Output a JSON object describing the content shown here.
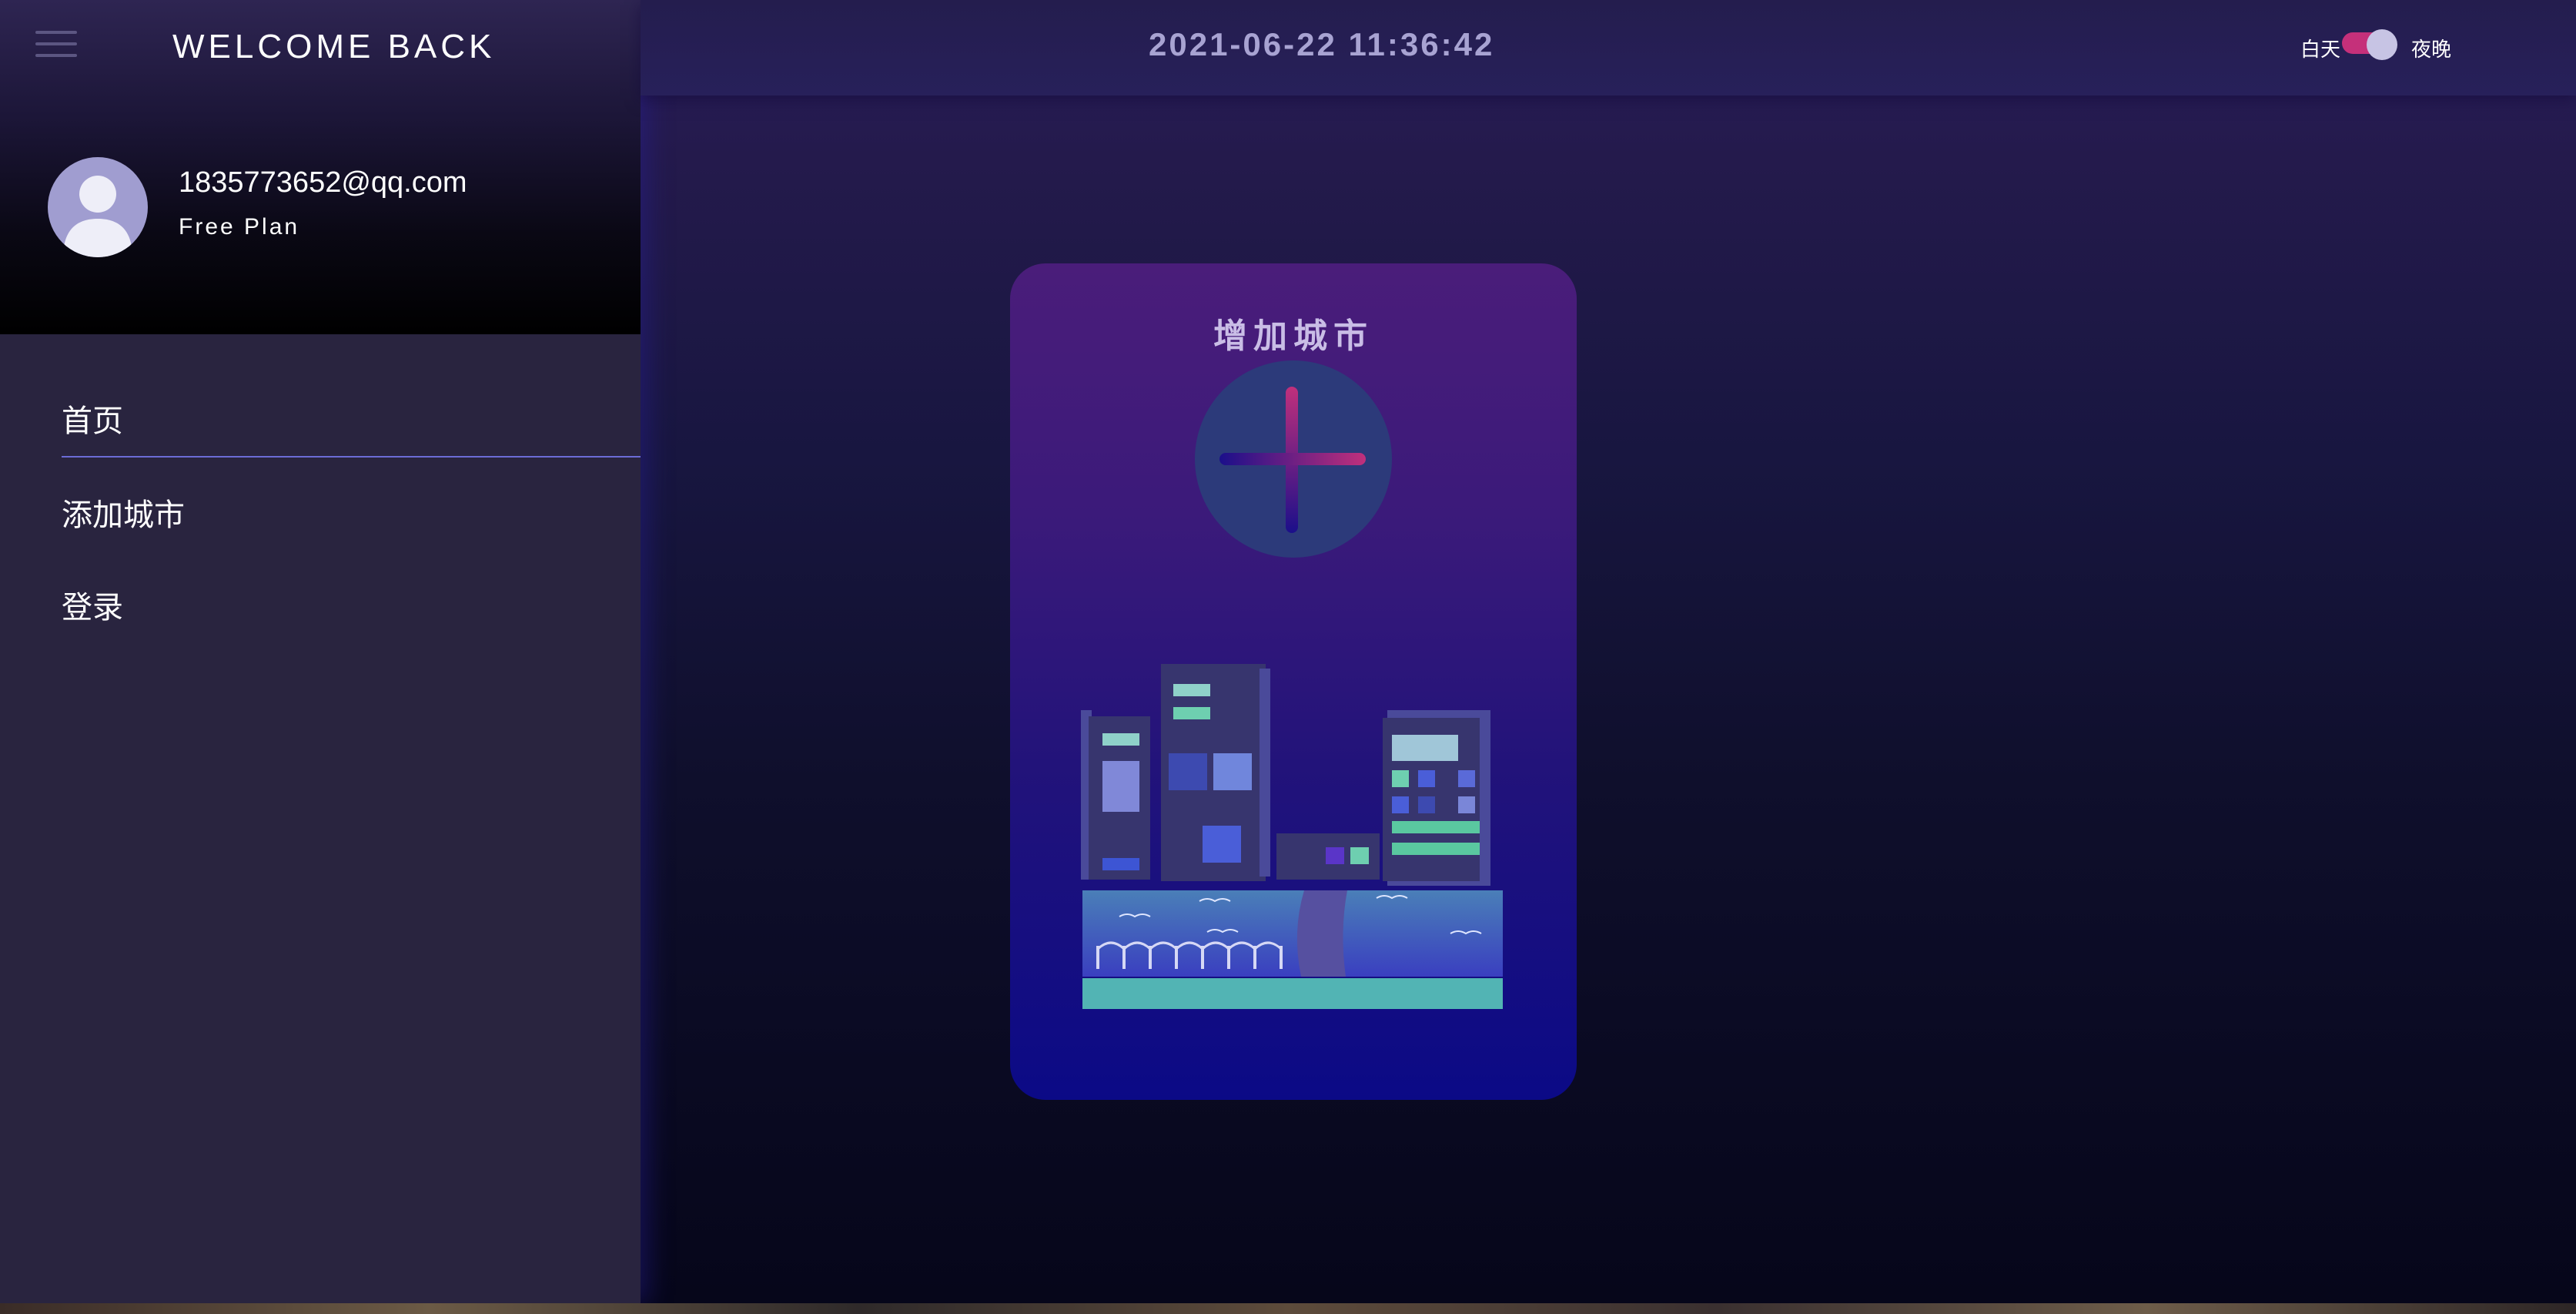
{
  "sidebar": {
    "welcome": "WELCOME BACK",
    "user": {
      "email": "1835773652@qq.com",
      "plan": "Free Plan"
    },
    "nav": [
      {
        "label": "首页",
        "active": true
      },
      {
        "label": "添加城市"
      },
      {
        "label": "登录"
      }
    ]
  },
  "header": {
    "datetime": "2021-06-22 11:36:42",
    "theme_toggle": {
      "day_label": "白天",
      "night_label": "夜晚",
      "state": "night"
    }
  },
  "card": {
    "title": "增加城市",
    "icon": "plus-icon"
  },
  "colors": {
    "accent": "#c5307a",
    "nav_underline": "#6b6bd6",
    "sidebar_bg": "#29243f"
  }
}
